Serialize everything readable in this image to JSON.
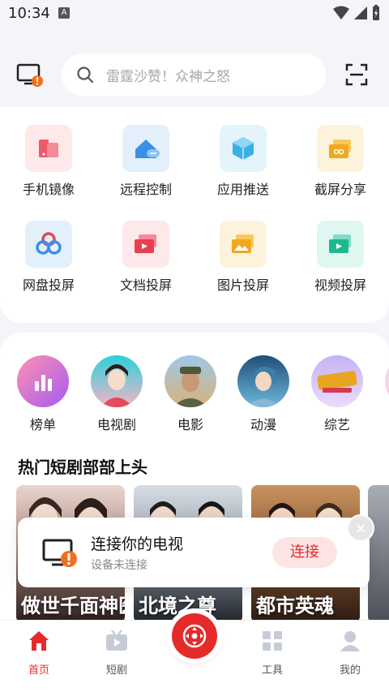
{
  "status_bar": {
    "time": "10:34",
    "notification_letter": "A"
  },
  "header": {
    "search_placeholder": "雷霆沙赞！众神之怒"
  },
  "tools": [
    {
      "label": "手机镜像",
      "icon": "phone-mirror-icon"
    },
    {
      "label": "远程控制",
      "icon": "remote-control-icon"
    },
    {
      "label": "应用推送",
      "icon": "app-push-icon"
    },
    {
      "label": "截屏分享",
      "icon": "screenshot-share-icon"
    },
    {
      "label": "网盘投屏",
      "icon": "cloud-cast-icon"
    },
    {
      "label": "文档投屏",
      "icon": "document-cast-icon"
    },
    {
      "label": "图片投屏",
      "icon": "image-cast-icon"
    },
    {
      "label": "视频投屏",
      "icon": "video-cast-icon"
    }
  ],
  "categories": [
    {
      "label": "榜单"
    },
    {
      "label": "电视剧"
    },
    {
      "label": "电影"
    },
    {
      "label": "动漫"
    },
    {
      "label": "综艺"
    }
  ],
  "section": {
    "title": "热门短剧部部上头"
  },
  "posters": [
    {
      "title": "做世千面神医"
    },
    {
      "title": "北境之尊"
    },
    {
      "title": "都市英魂"
    }
  ],
  "connect_banner": {
    "title": "连接你的电视",
    "subtitle": "设备未连接",
    "button": "连接",
    "close": "✕"
  },
  "bottom_nav": [
    {
      "label": "首页",
      "icon": "home-icon",
      "active": true
    },
    {
      "label": "短剧",
      "icon": "short-drama-icon",
      "active": false
    },
    {
      "label": "工具",
      "icon": "tools-grid-icon",
      "active": false
    },
    {
      "label": "我的",
      "icon": "profile-icon",
      "active": false
    }
  ],
  "colors": {
    "accent": "#e52a2a",
    "background": "#f4f5f9"
  }
}
